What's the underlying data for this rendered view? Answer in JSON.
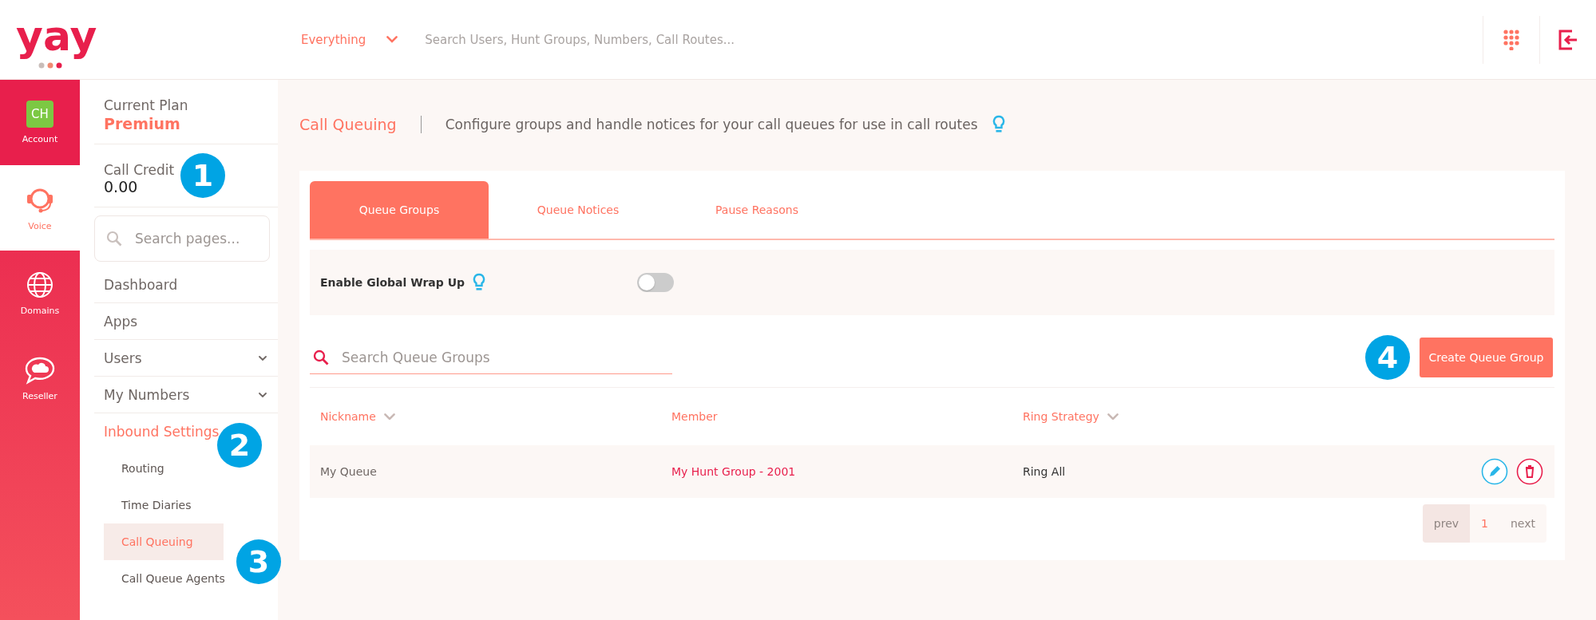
{
  "top_bar": {
    "logo": "yay",
    "scope": "Everything",
    "search_placeholder": "Search Users, Hunt Groups, Numbers, Call Routes..."
  },
  "rail": [
    {
      "kind": "avatar",
      "initials": "CH",
      "label": "Account",
      "selected": false
    },
    {
      "kind": "headset",
      "label": "Voice",
      "selected": true
    },
    {
      "kind": "globe",
      "label": "Domains",
      "selected": false
    },
    {
      "kind": "chat-cloud",
      "label": "Reseller",
      "selected": false
    }
  ],
  "sidebar": {
    "plan_label": "Current Plan",
    "plan": "Premium",
    "credit_label": "Call Credit",
    "credit": "0.00",
    "search_placeholder": "Search pages...",
    "items": [
      {
        "label": "Dashboard",
        "kind": "link",
        "selected": false
      },
      {
        "label": "Apps",
        "kind": "link",
        "selected": false
      },
      {
        "label": "Users",
        "kind": "dropdown",
        "selected": false
      },
      {
        "label": "My Numbers",
        "kind": "dropdown",
        "selected": false
      },
      {
        "label": "Inbound Settings",
        "kind": "group",
        "selected": true,
        "children": [
          {
            "label": "Routing",
            "selected": false
          },
          {
            "label": "Time Diaries",
            "selected": false
          },
          {
            "label": "Call Queuing",
            "selected": true
          },
          {
            "label": "Call Queue Agents",
            "selected": false
          }
        ]
      }
    ]
  },
  "page": {
    "title": "Call Queuing",
    "description": "Configure groups and handle notices for your call queues for use in call routes",
    "tabs": [
      {
        "label": "Queue Groups",
        "selected": true
      },
      {
        "label": "Queue Notices",
        "selected": false
      },
      {
        "label": "Pause Reasons",
        "selected": false
      }
    ],
    "wrap_up": {
      "label": "Enable Global Wrap Up",
      "on": false
    },
    "search_placeholder": "Search Queue Groups",
    "create_button": "Create Queue Group",
    "table": {
      "columns": [
        {
          "label": "Nickname",
          "sortable": true
        },
        {
          "label": "Member",
          "sortable": false
        },
        {
          "label": "Ring Strategy",
          "sortable": true
        }
      ],
      "rows": [
        {
          "nickname": "My Queue",
          "member": "My Hunt Group - 2001",
          "ring_strategy": "Ring All"
        }
      ]
    },
    "pagination": {
      "prev": "prev",
      "prev_disabled": true,
      "pages": [
        {
          "label": "1",
          "selected": true
        }
      ],
      "next": "next",
      "next_disabled": true
    }
  },
  "callouts": [
    {
      "number": "1"
    },
    {
      "number": "2"
    },
    {
      "number": "3"
    },
    {
      "number": "4"
    }
  ]
}
